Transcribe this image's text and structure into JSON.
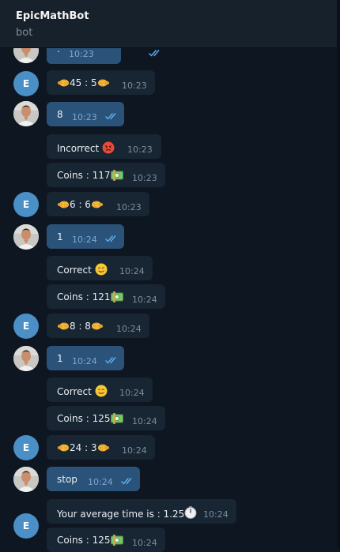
{
  "chat": {
    "title": "EpicMathBot",
    "subtitle": "bot"
  },
  "bot_avatar_letter": "E",
  "messages": [
    {
      "text": ":",
      "time": "10:23"
    },
    {
      "text": "45 : 5",
      "time": "10:23"
    },
    {
      "text": "8",
      "time": "10:23"
    },
    {
      "text": "Incorrect",
      "time": "10:23"
    },
    {
      "text": "Coins : 117",
      "time": "10:23"
    },
    {
      "text": "6 : 6",
      "time": "10:23"
    },
    {
      "text": "1",
      "time": "10:24"
    },
    {
      "text": "Correct",
      "time": "10:24"
    },
    {
      "text": "Coins : 121",
      "time": "10:24"
    },
    {
      "text": "8 : 8",
      "time": "10:24"
    },
    {
      "text": "1",
      "time": "10:24"
    },
    {
      "text": "Correct",
      "time": "10:24"
    },
    {
      "text": "Coins : 125",
      "time": "10:24"
    },
    {
      "text": "24 : 3",
      "time": "10:24"
    },
    {
      "text": "stop",
      "time": "10:24"
    },
    {
      "text": "Your average time is : 1.25",
      "time": "10:24"
    },
    {
      "text": "Coins : 125",
      "time": "10:24"
    }
  ],
  "colors": {
    "background": "#0e1621",
    "header": "#17212b",
    "outgoing_bubble": "#2b5278",
    "incoming_bubble": "#182533",
    "bot_avatar": "#4b8fc7",
    "read_check": "#5fb2f1"
  }
}
